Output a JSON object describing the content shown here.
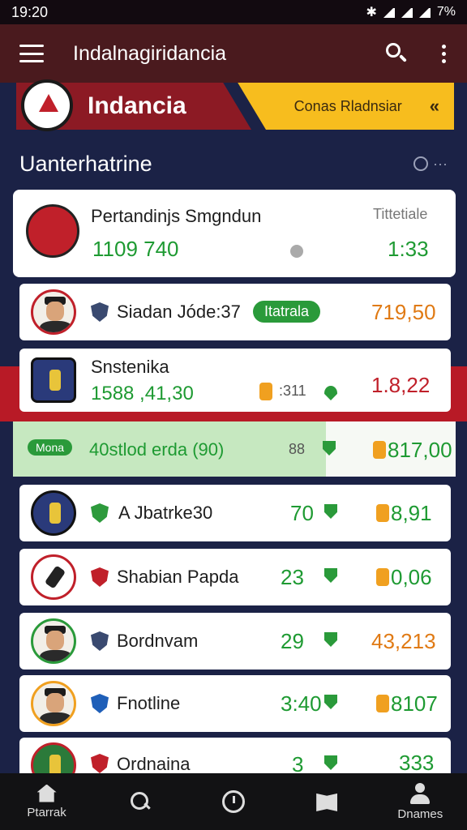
{
  "status_bar": {
    "time": "19:20",
    "battery": "7%"
  },
  "app_bar": {
    "title": "Indalnagiridancia"
  },
  "banner": {
    "title": "Indancia",
    "subtitle": "Conas Rladnsiar",
    "arrow": "«"
  },
  "section": {
    "title": "Uanterhatrine",
    "more": "···"
  },
  "top_match": {
    "name": "Pertandinjs Smgndun",
    "score": "1109 740",
    "label": "Tittetiale",
    "odds": "1:33"
  },
  "rows": [
    {
      "name": "Siadan Jóde:37",
      "pill": "Itatrala",
      "odds": "719,50"
    },
    {
      "name": "Snstenika",
      "sub": "1588 ,41,30",
      "extra": ":311",
      "odds": "1.8,22"
    },
    {
      "name": "40stlod erda (90)",
      "tag": "Mona",
      "extra": "88",
      "odds": "817,00"
    },
    {
      "name": "A Jbatrke30",
      "extra": "70",
      "odds": "8,91"
    },
    {
      "name": "Shabian Papda",
      "extra": "23",
      "odds": "0,06"
    },
    {
      "name": "Bordnvam",
      "extra": "29",
      "odds": "43,213"
    },
    {
      "name": "Fnotline",
      "extra": "3:40",
      "odds": "8107"
    },
    {
      "name": "Ordnaina",
      "extra": "3",
      "odds": "333"
    }
  ],
  "bottom_nav": {
    "items": [
      {
        "label": "Ptarrak"
      },
      {
        "label": ""
      },
      {
        "label": ""
      },
      {
        "label": ""
      },
      {
        "label": "Dnames"
      }
    ]
  },
  "colors": {
    "app_bar": "#4a1a1e",
    "banner_red": "#8c1a24",
    "banner_yellow": "#f7bd1e",
    "accent_green": "#2a9a3a",
    "background": "#1b2246"
  }
}
